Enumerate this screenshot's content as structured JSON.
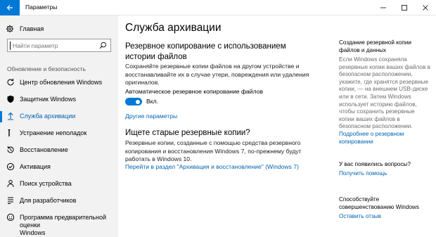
{
  "window": {
    "title": "Параметры",
    "accent": "#0078d7"
  },
  "sidebar": {
    "home_label": "Главная",
    "search_placeholder": "Найти параметр",
    "section_title": "Обновление и безопасность",
    "items": [
      {
        "label": "Центр обновления Windows",
        "icon": "refresh-icon"
      },
      {
        "label": "Защитник Windows",
        "icon": "shield-icon"
      },
      {
        "label": "Служба архивации",
        "icon": "upload-arrow-icon",
        "active": true
      },
      {
        "label": "Устранение неполадок",
        "icon": "wrench-icon"
      },
      {
        "label": "Восстановление",
        "icon": "history-icon"
      },
      {
        "label": "Активация",
        "icon": "check-circle-icon"
      },
      {
        "label": "Поиск устройства",
        "icon": "person-pin-icon"
      },
      {
        "label": "Для разработчиков",
        "icon": "code-bars-icon"
      },
      {
        "label_line1": "Программа предварительной оценки",
        "label_line2": "Windows",
        "icon": "smiley-icon"
      }
    ]
  },
  "main": {
    "title": "Служба архивации",
    "backup_heading_line1": "Резервное копирование с использованием",
    "backup_heading_line2": "истории файлов",
    "backup_desc_line1": "Сохраняйте резервные копии файлов на другом устройстве и",
    "backup_desc_line2": "восстанавливайте их в случае утери, повреждения или удаления",
    "backup_desc_line3": "оригиналов.",
    "toggle_caption": "Автоматическое резервное копирование файлов",
    "toggle_state": "Вкл.",
    "more_options_link": "Другие параметры",
    "old_heading": "Ищете старые резервные копии?",
    "old_desc_line1": "Резервные копии, созданные с помощью средства резервного",
    "old_desc_line2": "копирования и восстановления Windows 7, по-прежнему будут",
    "old_desc_line3": "работать в Windows 10.",
    "old_link": "Перейти в раздел \"Архивация и восстановление\" (Windows 7)"
  },
  "right": {
    "head1_line1": "Создание резервной копии",
    "head1_line2": "файлов и данных",
    "text_lines": [
      "Если Windows сохраняла",
      "резервные копии ваших файлов в",
      "безопасном расположении,",
      "укажите, где хранятся резервные",
      "копии, — на внешнем USB-диске",
      "или в сети. Затем Windows",
      "использует историю файлов,",
      "чтобы сохранить резервные",
      "копии ваших файлов в",
      "безопасном расположении."
    ],
    "link1_line1": "Подробнее о резервном",
    "link1_line2": "копировании",
    "head2": "У вас появились вопросы?",
    "link2": "Получить помощь",
    "head3_line1": "Способствуйте",
    "head3_line2": "совершенствованию Windows",
    "link3": "Оставить отзыв"
  }
}
